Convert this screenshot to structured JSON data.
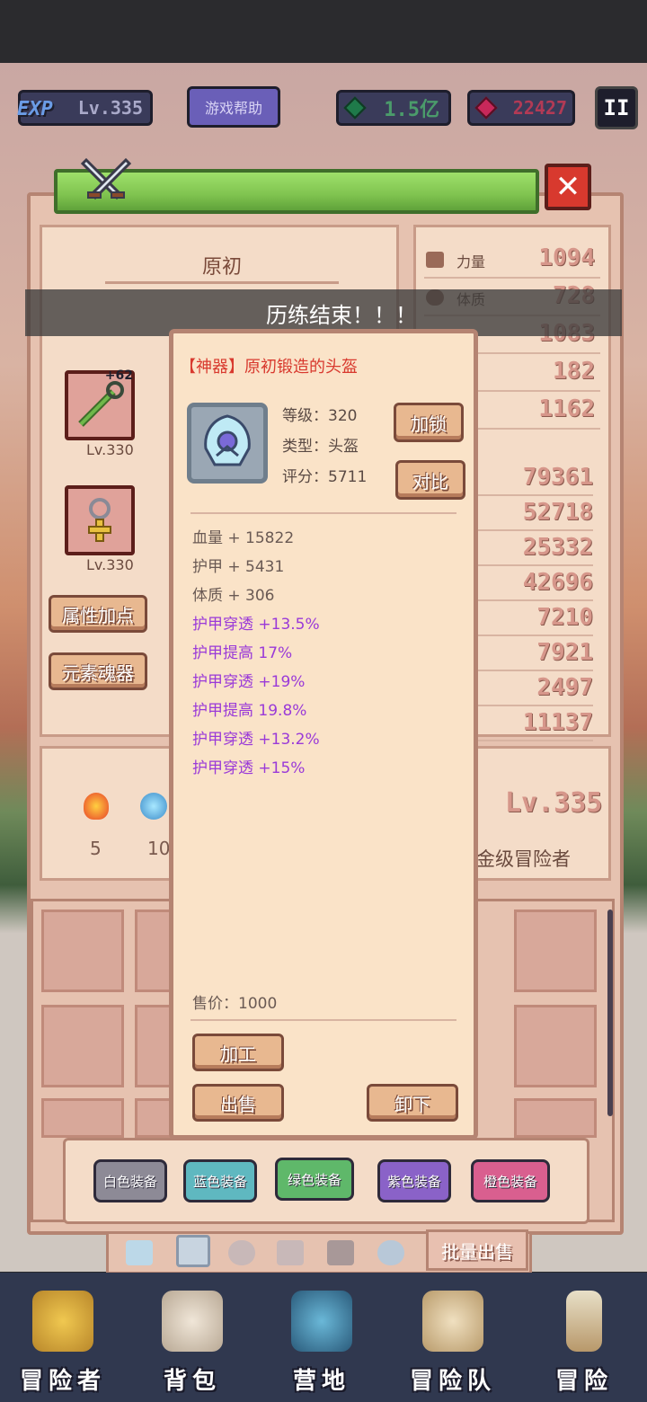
{
  "hud": {
    "exp_badge": "EXP",
    "level": "Lv.335",
    "help": "游戏帮助",
    "green_currency": "1.5亿",
    "red_currency": "22427",
    "pause": "II"
  },
  "panel": {
    "title": "原初",
    "close": "✕",
    "banner": "历练结束！！！",
    "slots": [
      {
        "plus": "+62",
        "level": "Lv.330"
      },
      {
        "level": "Lv.330"
      }
    ],
    "buttons": {
      "attr_points": "属性加点",
      "element_soul": "元素魂器"
    },
    "elements": [
      {
        "count": "5"
      },
      {
        "count": "10"
      }
    ],
    "adventurer_level": "Lv.335",
    "adventurer_rank": "金级冒险者"
  },
  "stats": [
    {
      "name": "力量",
      "value": "1094"
    },
    {
      "name": "体质",
      "value": "728"
    },
    {
      "name": "",
      "value": "1083"
    },
    {
      "name": "",
      "value": "182"
    },
    {
      "name": "",
      "value": "1162"
    }
  ],
  "stats2": [
    "79361",
    "52718",
    "25332",
    "42696",
    "7210",
    "7921",
    "2497",
    "11137"
  ],
  "item": {
    "title": "【神器】原初锻造的头盔",
    "level": "等级：320",
    "type": "类型：头盔",
    "score": "评分：5711",
    "lock": "加锁",
    "compare": "对比",
    "base_attrs": [
      "血量 + 15822",
      "护甲 + 5431",
      "体质 + 306"
    ],
    "bonus_attrs": [
      "护甲穿透 +13.5%",
      "护甲提高 17%",
      "护甲穿透 +19%",
      "护甲提高 19.8%",
      "护甲穿透 +13.2%",
      "护甲穿透 +15%"
    ],
    "price": "售价：1000",
    "process": "加工",
    "sell": "出售",
    "unequip": "卸下"
  },
  "filters": [
    {
      "label": "白色装备",
      "color": "#8d8a96"
    },
    {
      "label": "蓝色装备",
      "color": "#5fb8c0"
    },
    {
      "label": "绿色装备",
      "color": "#5fb86a"
    },
    {
      "label": "紫色装备",
      "color": "#8a62c8"
    },
    {
      "label": "橙色装备",
      "color": "#d95f8f"
    }
  ],
  "bulk_sell": "批量出售",
  "nav": [
    {
      "label": "冒险者",
      "icon": "crown-icon"
    },
    {
      "label": "背包",
      "icon": "backpack-icon"
    },
    {
      "label": "营地",
      "icon": "camp-banner-icon"
    },
    {
      "label": "冒险队",
      "icon": "scroll-book-icon"
    },
    {
      "label": "冒险",
      "icon": "sword-icon"
    }
  ]
}
